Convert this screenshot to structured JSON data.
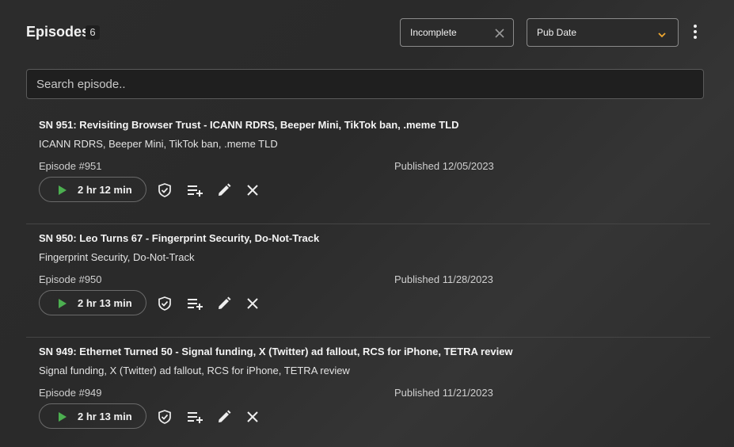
{
  "header": {
    "title": "Episodes",
    "count": "6",
    "filter_value": "Incomplete",
    "sort_value": "Pub Date"
  },
  "search": {
    "placeholder": "Search episode.."
  },
  "episodes": [
    {
      "title": "SN 951: Revisiting Browser Trust - ICANN RDRS, Beeper Mini, TikTok ban, .meme TLD",
      "subtitle": "ICANN RDRS, Beeper Mini, TikTok ban, .meme TLD",
      "number": "Episode #951",
      "published": "Published 12/05/2023",
      "duration": "2 hr 12 min"
    },
    {
      "title": "SN 950: Leo Turns 67 - Fingerprint Security, Do-Not-Track",
      "subtitle": "Fingerprint Security, Do-Not-Track",
      "number": "Episode #950",
      "published": "Published 11/28/2023",
      "duration": "2 hr 13 min"
    },
    {
      "title": "SN 949: Ethernet Turned 50 - Signal funding, X (Twitter) ad fallout, RCS for iPhone, TETRA review",
      "subtitle": "Signal funding, X (Twitter) ad fallout, RCS for iPhone, TETRA review",
      "number": "Episode #949",
      "published": "Published 11/21/2023",
      "duration": "2 hr 13 min"
    }
  ],
  "colors": {
    "play_accent": "#4caf50",
    "sort_chevron": "#f0a830"
  },
  "icons": [
    "close-icon",
    "chevron-down-icon",
    "more-vert-icon",
    "play-icon",
    "shield-check-icon",
    "playlist-add-icon",
    "edit-icon",
    "delete-icon"
  ]
}
